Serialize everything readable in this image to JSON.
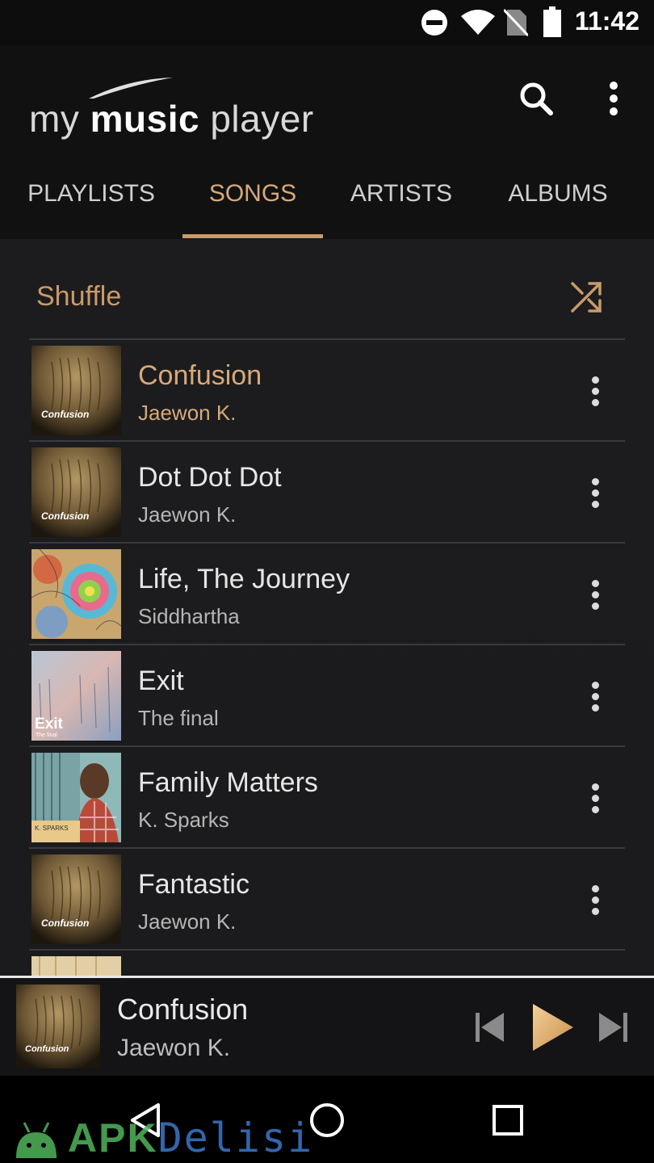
{
  "status": {
    "time": "11:42",
    "icons": [
      "do-not-disturb-icon",
      "wifi-icon",
      "no-sim-icon",
      "battery-icon"
    ]
  },
  "app": {
    "logo": {
      "my": "my",
      "music": "music",
      "player": "player"
    }
  },
  "tabs": [
    {
      "label": "PLAYLISTS",
      "active": false
    },
    {
      "label": "SONGS",
      "active": true
    },
    {
      "label": "ARTISTS",
      "active": false
    },
    {
      "label": "ALBUMS",
      "active": false
    }
  ],
  "shuffle": {
    "label": "Shuffle"
  },
  "songs": [
    {
      "title": "Confusion",
      "artist": "Jaewon K.",
      "art": "confusion",
      "art_text": "Confusion",
      "playing": true
    },
    {
      "title": "Dot Dot Dot",
      "artist": "Jaewon K.",
      "art": "confusion",
      "art_text": "Confusion",
      "playing": false
    },
    {
      "title": "Life, The Journey",
      "artist": "Siddhartha",
      "art": "psychedelic",
      "playing": false
    },
    {
      "title": "Exit",
      "artist": "The final",
      "art": "exit",
      "art_text": "Exit",
      "art_subtext": "The final",
      "playing": false
    },
    {
      "title": "Family Matters",
      "artist": "K. Sparks",
      "art": "portrait",
      "art_text": "K. SPARKS",
      "playing": false
    },
    {
      "title": "Fantastic",
      "artist": "Jaewon K.",
      "art": "confusion",
      "art_text": "Confusion",
      "playing": false
    }
  ],
  "now_playing": {
    "title": "Confusion",
    "artist": "Jaewon K.",
    "art_text": "Confusion"
  },
  "colors": {
    "accent": "#c99a6a",
    "background": "#1c1c1e",
    "appbar": "#111112"
  },
  "watermark": {
    "apk": "APK",
    "delisi": "Delisi"
  }
}
